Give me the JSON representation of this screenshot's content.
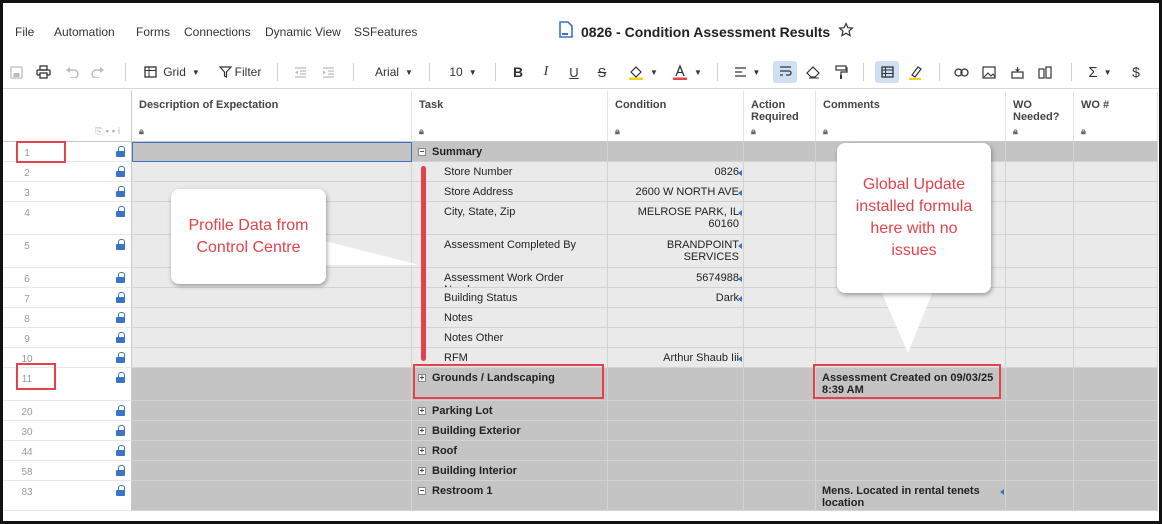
{
  "menu": [
    "File",
    "Automation",
    "Forms",
    "Connections",
    "Dynamic View",
    "SSFeatures"
  ],
  "document": {
    "title": "0826 - Condition Assessment Results"
  },
  "toolbar": {
    "view_label": "Grid",
    "filter_label": "Filter",
    "font": "Arial",
    "font_size": "10",
    "currency": "$"
  },
  "columns": [
    {
      "label": "Description of Expectation"
    },
    {
      "label": "Task"
    },
    {
      "label": "Condition"
    },
    {
      "label": "Action Required"
    },
    {
      "label": "Comments"
    },
    {
      "label": "WO Needed?"
    },
    {
      "label": "WO #"
    }
  ],
  "rows": [
    {
      "num": "1",
      "task": "Summary",
      "condition": "",
      "comment": "",
      "kind": "parent-collapse"
    },
    {
      "num": "2",
      "task": "Store Number",
      "condition": "0826",
      "comment": "",
      "kind": "child"
    },
    {
      "num": "3",
      "task": "Store Address",
      "condition": "2600 W NORTH AVE",
      "comment": "",
      "kind": "child"
    },
    {
      "num": "4",
      "task": "City, State, Zip",
      "condition": "MELROSE PARK, IL 60160",
      "comment": "",
      "kind": "child"
    },
    {
      "num": "5",
      "task": "Assessment Completed By",
      "condition": "BRANDPOINT SERVICES",
      "comment": "",
      "kind": "child"
    },
    {
      "num": "6",
      "task": "Assessment Work Order Number",
      "condition": "5674988",
      "comment": "",
      "kind": "child"
    },
    {
      "num": "7",
      "task": "Building Status",
      "condition": "Dark",
      "comment": "",
      "kind": "child"
    },
    {
      "num": "8",
      "task": "Notes",
      "condition": "",
      "comment": "",
      "kind": "child"
    },
    {
      "num": "9",
      "task": "Notes Other",
      "condition": "",
      "comment": "",
      "kind": "child"
    },
    {
      "num": "10",
      "task": "RFM",
      "condition": "Arthur Shaub Iii",
      "comment": "",
      "kind": "child"
    },
    {
      "num": "11",
      "task": "Grounds / Landscaping",
      "condition": "",
      "comment": "Assessment Created on 09/03/25 8:39 AM",
      "kind": "parent-expand"
    },
    {
      "num": "20",
      "task": "Parking Lot",
      "condition": "",
      "comment": "",
      "kind": "parent-expand"
    },
    {
      "num": "30",
      "task": "Building Exterior",
      "condition": "",
      "comment": "",
      "kind": "parent-expand"
    },
    {
      "num": "44",
      "task": "Roof",
      "condition": "",
      "comment": "",
      "kind": "parent-expand"
    },
    {
      "num": "58",
      "task": "Building Interior",
      "condition": "",
      "comment": "",
      "kind": "parent-expand"
    },
    {
      "num": "83",
      "task": "Restroom 1",
      "condition": "",
      "comment": "Mens. Located in rental tenets location",
      "kind": "parent-collapse"
    }
  ],
  "annotations": {
    "left_callout": "Profile Data from Control Centre",
    "right_callout": "Global Update installed formula here with no issues"
  },
  "colors": {
    "accent": "#e2434b",
    "lock": "#3a74c4",
    "parent_row": "#c4c4c4",
    "child_row": "#eaeaea"
  }
}
